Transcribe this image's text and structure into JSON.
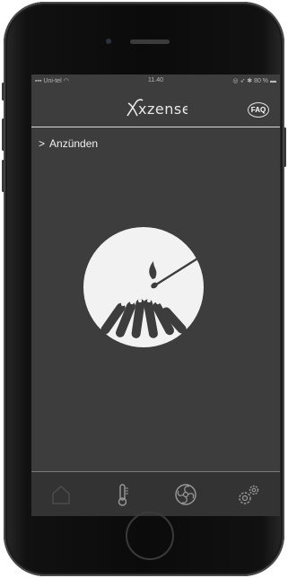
{
  "status_bar": {
    "carrier": "Uni-tel",
    "time": "11.40",
    "battery": "80 %"
  },
  "header": {
    "logo_text": "xzense",
    "faq_label": "FAQ"
  },
  "breadcrumb": {
    "chevron": ">",
    "label": "Anzünden"
  },
  "main": {
    "illustration": "campfire-match-icon"
  },
  "tab_bar": {
    "items": [
      {
        "icon": "home-icon",
        "active": true
      },
      {
        "icon": "thermometer-icon",
        "active": false
      },
      {
        "icon": "fan-icon",
        "active": false
      },
      {
        "icon": "gears-icon",
        "active": false
      }
    ]
  },
  "colors": {
    "screen_bg": "#3d3d3d",
    "tabbar_bg": "#333333",
    "circle_bg": "#f2f2f2",
    "icon_dark": "#3d3d3d"
  }
}
